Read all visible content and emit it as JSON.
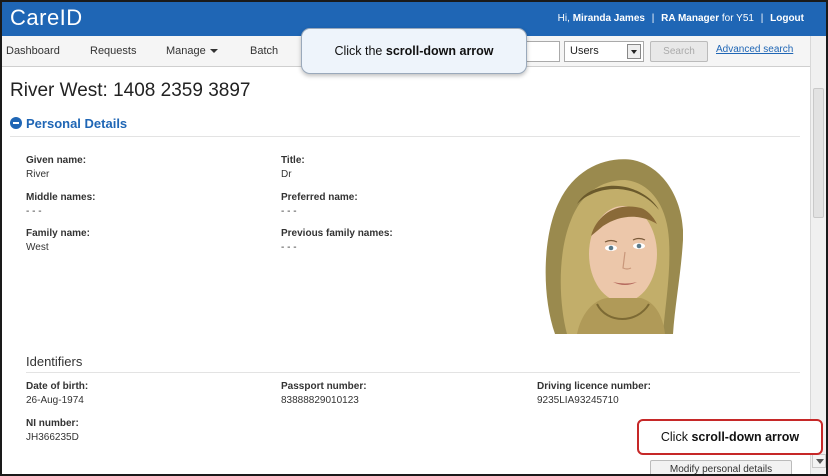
{
  "header": {
    "logo": "CareID",
    "greeting": "Hi,",
    "user_name": "Miranda James",
    "role": "RA Manager",
    "role_suffix": "for Y51",
    "logout": "Logout",
    "bar_color": "#1f66b5"
  },
  "nav": {
    "items": [
      {
        "label": "Dashboard"
      },
      {
        "label": "Requests"
      },
      {
        "label": "Manage"
      },
      {
        "label": "Batch"
      }
    ],
    "search_placeholder": "",
    "search_type": "Users",
    "search_button": "Search",
    "advanced_search": "Advanced search"
  },
  "page": {
    "title": "River West: 1408 2359 3897"
  },
  "personal_details": {
    "heading": "Personal Details",
    "given_name": {
      "label": "Given name:",
      "value": "River"
    },
    "title": {
      "label": "Title:",
      "value": "Dr"
    },
    "middle_names": {
      "label": "Middle names:",
      "value": "- - -"
    },
    "preferred_name": {
      "label": "Preferred name:",
      "value": "- - -"
    },
    "family_name": {
      "label": "Family name:",
      "value": "West"
    },
    "previous_family_names": {
      "label": "Previous family names:",
      "value": "- - -"
    }
  },
  "identifiers": {
    "heading": "Identifiers",
    "date_of_birth": {
      "label": "Date of birth:",
      "value": "26-Aug-1974"
    },
    "passport_number": {
      "label": "Passport number:",
      "value": "83888829010123"
    },
    "driving_licence_number": {
      "label": "Driving licence number:",
      "value": "9235LIA93245710"
    },
    "ni_number": {
      "label": "NI number:",
      "value": "JH366235D"
    }
  },
  "actions": {
    "modify": "Modify personal details"
  },
  "callouts": {
    "top_prefix": "Click the",
    "top_bold": "scroll-down arrow",
    "bottom_prefix": "Click",
    "bottom_bold": "scroll-down arrow"
  },
  "icons": {
    "section_toggle": "minus-circle-icon",
    "select_caret": "chevron-down-icon",
    "scroll_down": "arrow-down-icon"
  }
}
